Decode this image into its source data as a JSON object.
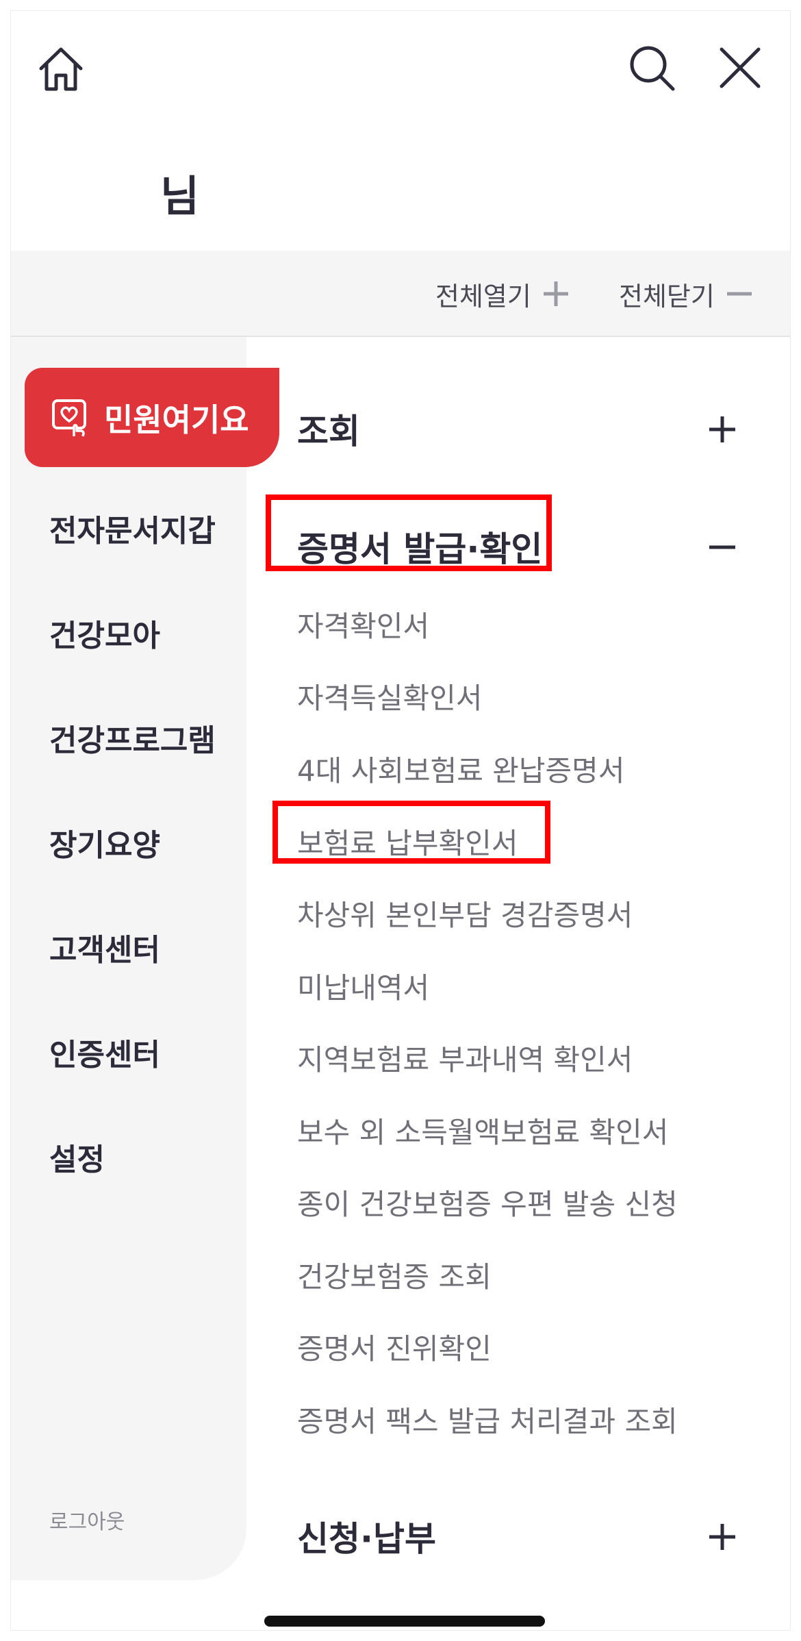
{
  "header": {
    "home_icon": "home-icon",
    "search_icon": "search-icon",
    "close_icon": "close-icon",
    "user_name": "님"
  },
  "toolbar": {
    "expand_all": "전체열기",
    "collapse_all": "전체닫기"
  },
  "sidebar": {
    "active": {
      "label": "민원여기요",
      "icon": "heart-hand-icon"
    },
    "items": [
      {
        "label": "전자문서지갑"
      },
      {
        "label": "건강모아"
      },
      {
        "label": "건강프로그램"
      },
      {
        "label": "장기요양"
      },
      {
        "label": "고객센터"
      },
      {
        "label": "인증센터"
      },
      {
        "label": "설정"
      }
    ],
    "logout": "로그아웃"
  },
  "content": {
    "sections": [
      {
        "title": "조회",
        "state": "collapsed"
      },
      {
        "title": "증명서 발급·확인",
        "state": "expanded",
        "items": [
          "자격확인서",
          "자격득실확인서",
          "4대 사회보험료 완납증명서",
          "보험료 납부확인서",
          "차상위 본인부담 경감증명서",
          "미납내역서",
          "지역보험료 부과내역 확인서",
          "보수 외 소득월액보험료 확인서",
          "종이 건강보험증 우편 발송 신청",
          "건강보험증 조회",
          "증명서 진위확인",
          "증명서 팩스 발급 처리결과 조회"
        ]
      },
      {
        "title": "신청·납부",
        "state": "collapsed"
      }
    ]
  },
  "colors": {
    "accent": "#e0343b",
    "highlight_box": "#ff0000",
    "sidebar_bg": "#f5f5f6",
    "text_dark": "#2b2b3a",
    "text_muted": "#6f6f78"
  }
}
